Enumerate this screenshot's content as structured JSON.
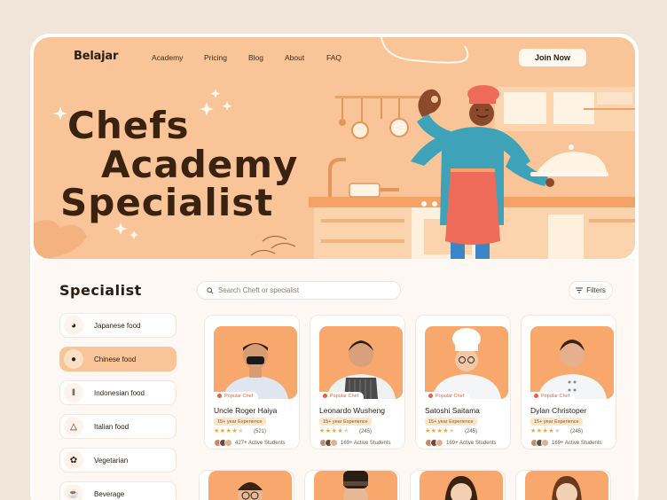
{
  "nav": {
    "logo": "Belajar",
    "links": [
      "Academy",
      "Pricing",
      "Blog",
      "About",
      "FAQ"
    ],
    "join_label": "Join Now"
  },
  "hero": {
    "line1": "Chefs",
    "line2": "Academy",
    "line3": "Specialist"
  },
  "section_title": "Specialist",
  "search": {
    "placeholder": "Search Cheft or specialist",
    "icon": "search-icon"
  },
  "filters_label": "Filters",
  "categories": [
    {
      "label": "Japanese food",
      "icon": "bowl-icon",
      "active": false
    },
    {
      "label": "Chinese food",
      "icon": "dumpling-icon",
      "active": true
    },
    {
      "label": "Indonesian food",
      "icon": "chopsticks-icon",
      "active": false
    },
    {
      "label": "Italian food",
      "icon": "pizza-icon",
      "active": false
    },
    {
      "label": "Vegetarian",
      "icon": "leaf-icon",
      "active": false
    },
    {
      "label": "Beverage",
      "icon": "cup-icon",
      "active": false
    }
  ],
  "chefs": [
    {
      "badge": "Popular Chef",
      "name": "Uncle Roger Haiya",
      "experience": "15+ year Experience",
      "rating": 4,
      "reviews": "(521)",
      "students": "427+ Active Students"
    },
    {
      "badge": "Popular Chef",
      "name": "Leonardo Wusheng",
      "experience": "15+ year Experience",
      "rating": 4,
      "reviews": "(245)",
      "students": "169+ Active Students"
    },
    {
      "badge": "Popular Chef",
      "name": "Satoshi Saitama",
      "experience": "15+ year Experience",
      "rating": 4,
      "reviews": "(245)",
      "students": "169+ Active Students"
    },
    {
      "badge": "Popular Chef",
      "name": "Dylan Christoper",
      "experience": "15+ year Experience",
      "rating": 4,
      "reviews": "(245)",
      "students": "169+ Active Students"
    }
  ],
  "colors": {
    "accent": "#f9c598",
    "card_photo": "#f8a86c",
    "badge": "#e4613f",
    "star": "#f5a623"
  }
}
